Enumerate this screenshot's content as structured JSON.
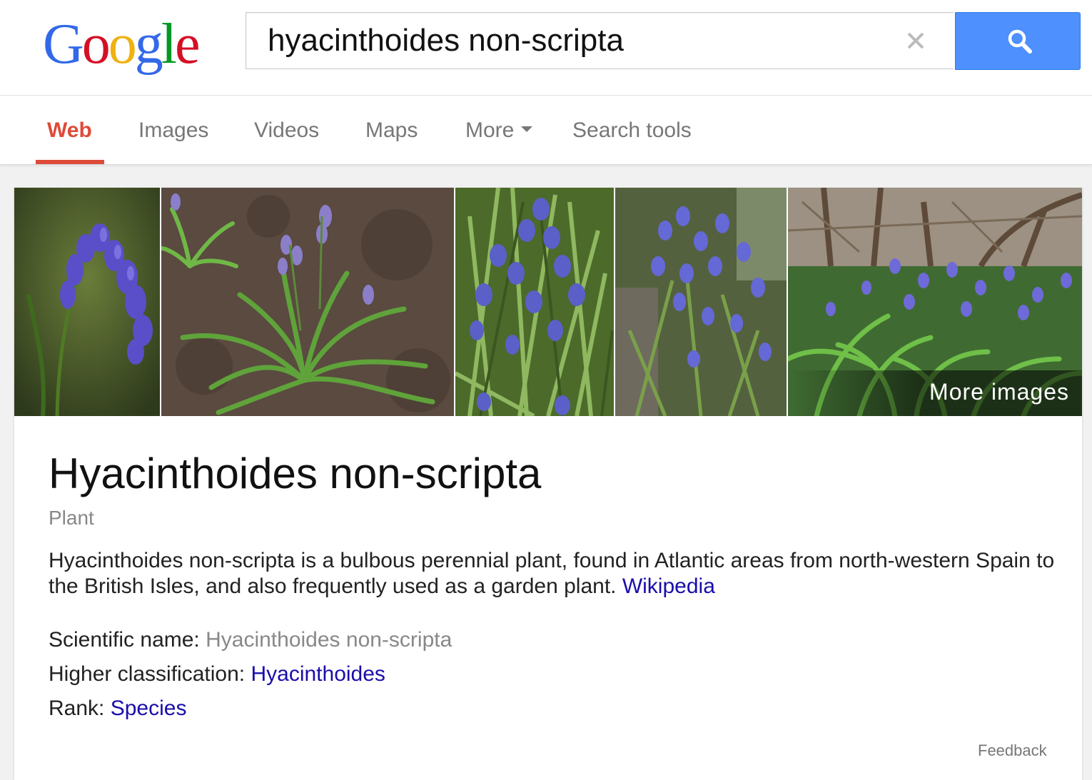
{
  "logo": {
    "letters": [
      "G",
      "o",
      "o",
      "g",
      "l",
      "e"
    ],
    "colors": [
      "#3369e8",
      "#d50f25",
      "#eeb211",
      "#3369e8",
      "#009925",
      "#d50f25"
    ]
  },
  "search": {
    "query": "hyacinthoides non-scripta"
  },
  "tabs": [
    {
      "label": "Web",
      "active": true
    },
    {
      "label": "Images"
    },
    {
      "label": "Videos"
    },
    {
      "label": "Maps"
    },
    {
      "label": "More"
    },
    {
      "label": "Search tools"
    }
  ],
  "images": {
    "more_label": "More images"
  },
  "knowledge_panel": {
    "title": "Hyacinthoides non-scripta",
    "subtitle": "Plant",
    "description": "Hyacinthoides non-scripta is a bulbous perennial plant, found in Atlantic areas from north-western Spain to the British Isles, and also frequently used as a garden plant.",
    "source_link": "Wikipedia",
    "facts": [
      {
        "label": "Scientific name:",
        "value": "Hyacinthoides non-scripta",
        "is_link": false
      },
      {
        "label": "Higher classification:",
        "value": "Hyacinthoides",
        "is_link": true
      },
      {
        "label": "Rank:",
        "value": "Species",
        "is_link": true
      }
    ],
    "feedback_label": "Feedback"
  },
  "colors": {
    "accent_red": "#dd4b39",
    "search_blue": "#4d90fe",
    "link_blue": "#1a0dab"
  }
}
